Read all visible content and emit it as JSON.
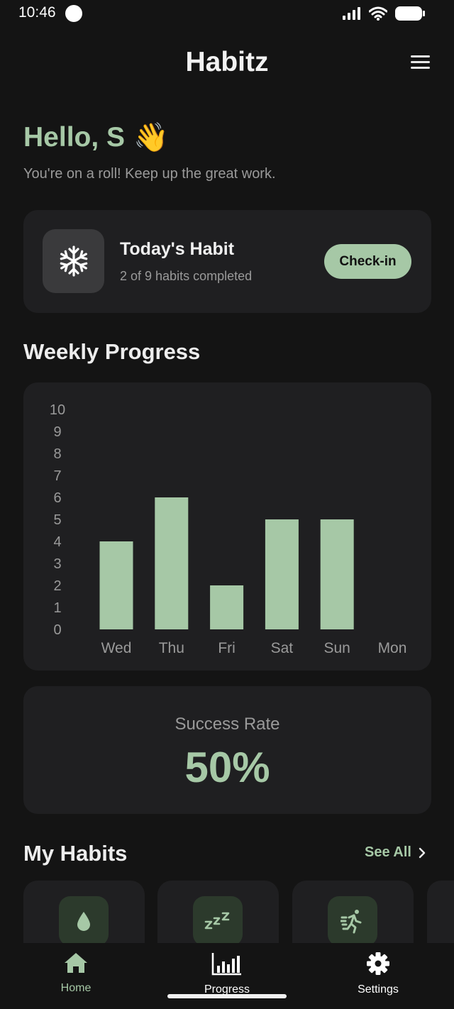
{
  "status_bar": {
    "time": "10:46"
  },
  "header": {
    "title": "Habitz",
    "menu_icon": "menu-icon"
  },
  "greeting": {
    "text": "Hello, S",
    "emoji": "👋",
    "subtitle": "You're on a roll! Keep up the great work."
  },
  "today_card": {
    "icon": "snowflake-icon",
    "title": "Today's Habit",
    "subtitle": "2 of 9 habits completed",
    "checkin_label": "Check-in"
  },
  "weekly": {
    "title": "Weekly Progress"
  },
  "chart_data": {
    "type": "bar",
    "title": "",
    "xlabel": "",
    "ylabel": "",
    "categories": [
      "Wed",
      "Thu",
      "Fri",
      "Sat",
      "Sun",
      "Mon"
    ],
    "values": [
      4,
      6,
      2,
      5,
      5,
      0
    ],
    "ylim": [
      0,
      10
    ],
    "yticks": [
      0,
      1,
      2,
      3,
      4,
      5,
      6,
      7,
      8,
      9,
      10
    ],
    "grid": false,
    "bar_color": "#a6c8a6"
  },
  "success": {
    "label": "Success Rate",
    "value": "50%"
  },
  "my_habits": {
    "title": "My Habits",
    "see_all": "See All",
    "items": [
      {
        "icon": "water-drop-icon"
      },
      {
        "icon": "sleep-icon"
      },
      {
        "icon": "running-icon"
      }
    ]
  },
  "nav": {
    "items": [
      {
        "label": "Home",
        "icon": "home-icon",
        "active": false,
        "color": "#a6c8a6"
      },
      {
        "label": "Progress",
        "icon": "bar-chart-icon",
        "active": true,
        "color": "#ffffff"
      },
      {
        "label": "Settings",
        "icon": "gear-icon",
        "active": false,
        "color": "#ffffff"
      }
    ]
  },
  "colors": {
    "accent": "#a6c8a6",
    "background": "#141414",
    "card": "#1f1f21"
  }
}
